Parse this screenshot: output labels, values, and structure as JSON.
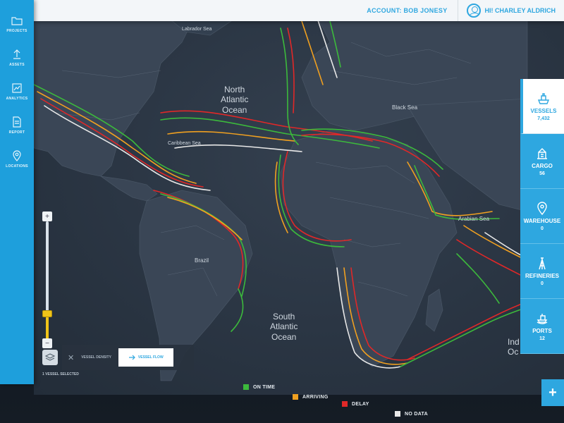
{
  "header": {
    "account_label": "ACCOUNT: BOB JONESY",
    "greeting": "HI! CHARLEY ALDRICH"
  },
  "sidebar": {
    "items": [
      {
        "label": "PROJECTS",
        "icon": "folder-icon"
      },
      {
        "label": "ASSETS",
        "icon": "upload-icon"
      },
      {
        "label": "ANALYTICS",
        "icon": "chart-icon"
      },
      {
        "label": "REPORT",
        "icon": "document-icon"
      },
      {
        "label": "LOCATIONS",
        "icon": "location-pin-icon"
      }
    ]
  },
  "stats": [
    {
      "label": "VESSELS",
      "value": "7,432",
      "icon": "ship-icon",
      "active": true
    },
    {
      "label": "CARGO",
      "value": "56",
      "icon": "crane-icon",
      "active": false
    },
    {
      "label": "WAREHOUSE",
      "value": "0",
      "icon": "location-pin-icon",
      "active": false
    },
    {
      "label": "REFINERIES",
      "value": "0",
      "icon": "refinery-tower-icon",
      "active": false
    },
    {
      "label": "PORTS",
      "value": "12",
      "icon": "port-icon",
      "active": false
    }
  ],
  "map": {
    "labels": {
      "north_atlantic": [
        "North",
        "Atlantic",
        "Ocean"
      ],
      "south_atlantic": [
        "South",
        "Atlantic",
        "Ocean"
      ],
      "black_sea": "Black Sea",
      "arabian_sea": "Arabian Sea",
      "caribbean_sea": "Caribbean Sea",
      "labrador_sea": "Labrador Sea",
      "brazil": "Brazil",
      "indian_partial": [
        "Ind",
        "Oc"
      ]
    }
  },
  "mode_panel": {
    "tab_density": "VESSEL DENSITY",
    "tab_flow": "VESSEL FLOW",
    "subtitle": "1 VESSEL SELECTED"
  },
  "legend": [
    {
      "label": "ON TIME",
      "color": "#3cb93c"
    },
    {
      "label": "ARRIVING",
      "color": "#f0a020"
    },
    {
      "label": "DELAY",
      "color": "#e02828"
    },
    {
      "label": "NO DATA",
      "color": "#e8e8e8"
    }
  ],
  "add_button": "+"
}
